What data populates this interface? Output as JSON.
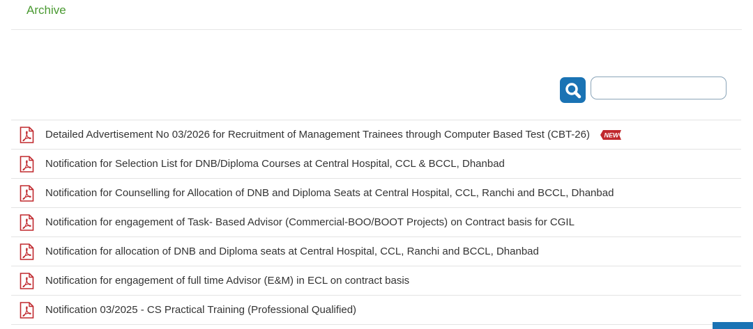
{
  "header": {
    "archive_label": "Archive"
  },
  "search": {
    "placeholder": "",
    "value": "",
    "button_icon": "search-icon",
    "accent_color": "#1a73b4"
  },
  "notifications": [
    {
      "title": "Detailed Advertisement No 03/2026 for Recruitment of Management Trainees through Computer Based Test (CBT-26)",
      "badge": "NEW"
    },
    {
      "title": "Notification for Selection List for DNB/Diploma Courses at Central Hospital, CCL & BCCL, Dhanbad"
    },
    {
      "title": "Notification for Counselling for Allocation of DNB and Diploma Seats at Central Hospital, CCL, Ranchi and BCCL, Dhanbad"
    },
    {
      "title": "Notification for engagement of Task- Based Advisor (Commercial-BOO/BOOT Projects) on Contract basis for CGIL"
    },
    {
      "title": "Notification for allocation of DNB and Diploma seats at Central Hospital, CCL, Ranchi and BCCL, Dhanbad"
    },
    {
      "title": "Notification for engagement of full time Advisor (E&M) in ECL on contract basis"
    },
    {
      "title": "Notification 03/2025 - CS Practical Training (Professional Qualified)"
    }
  ],
  "colors": {
    "archive_link": "#4a9a32",
    "pdf_icon": "#c0282d",
    "badge": "#c0282d"
  }
}
